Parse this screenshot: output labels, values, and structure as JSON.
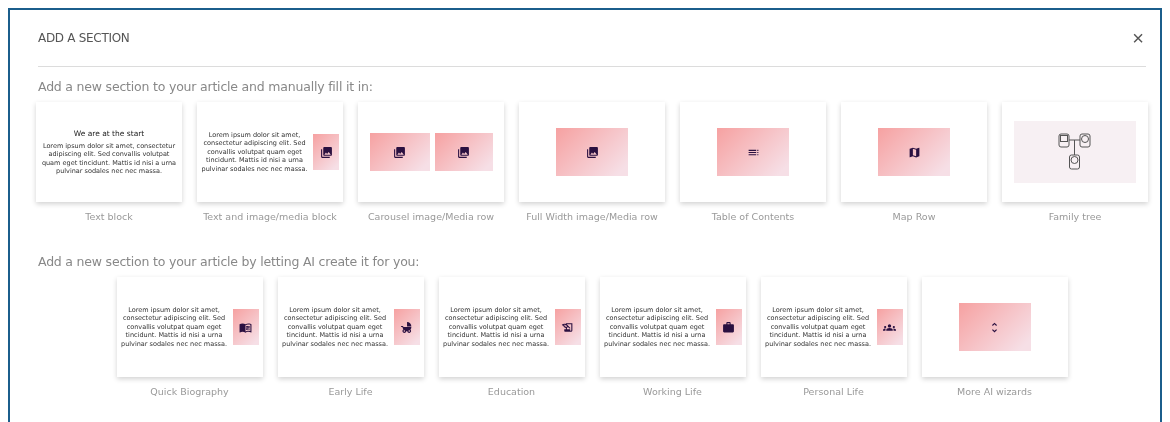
{
  "dialog": {
    "title": "ADD A SECTION",
    "close": "×"
  },
  "sections": [
    {
      "heading": "Add a new section to your article and manually fill it in:",
      "cards": [
        {
          "kind": "text",
          "label": "Text block",
          "title": "We are at the start",
          "body": "Lorem ipsum dolor sit amet, consectetur adipiscing elit. Sed convallis volutpat quam eget tincidunt. Mattis id nisi a urna pulvinar sodales nec nec massa."
        },
        {
          "kind": "text-media",
          "label": "Text and image/media block",
          "body": "Lorem ipsum dolor sit amet, consectetur adipiscing elit. Sed convallis volutpat quam eget tincidunt. Mattis id nisi a urna pulvinar sodales nec nec massa."
        },
        {
          "kind": "carousel",
          "label": "Carousel image/Media row"
        },
        {
          "kind": "media",
          "label": "Full Width image/Media row"
        },
        {
          "kind": "media",
          "label": "Table of Contents"
        },
        {
          "kind": "media",
          "label": "Map Row"
        },
        {
          "kind": "family-tree",
          "label": "Family tree"
        }
      ]
    },
    {
      "heading": "Add a new section to your article by letting AI create it for you:",
      "cards": [
        {
          "kind": "text-media",
          "label": "Quick Biography",
          "body": "Lorem ipsum dolor sit amet, consectetur adipiscing elit. Sed convallis volutpat quam eget tincidunt. Mattis id nisi a urna pulvinar sodales nec nec massa."
        },
        {
          "kind": "text-media",
          "label": "Early Life",
          "body": "Lorem ipsum dolor sit amet, consectetur adipiscing elit. Sed convallis volutpat quam eget tincidunt. Mattis id nisi a urna pulvinar sodales nec nec massa."
        },
        {
          "kind": "text-media",
          "label": "Education",
          "body": "Lorem ipsum dolor sit amet, consectetur adipiscing elit. Sed convallis volutpat quam eget tincidunt. Mattis id nisi a urna pulvinar sodales nec nec massa."
        },
        {
          "kind": "text-media",
          "label": "Working Life",
          "body": "Lorem ipsum dolor sit amet, consectetur adipiscing elit. Sed convallis volutpat quam eget tincidunt. Mattis id nisi a urna pulvinar sodales nec nec massa."
        },
        {
          "kind": "text-media",
          "label": "Personal Life",
          "body": "Lorem ipsum dolor sit amet, consectetur adipiscing elit. Sed convallis volutpat quam eget tincidunt. Mattis id nisi a urna pulvinar sodales nec nec massa."
        },
        {
          "kind": "media",
          "label": "More AI wizards"
        }
      ]
    }
  ]
}
